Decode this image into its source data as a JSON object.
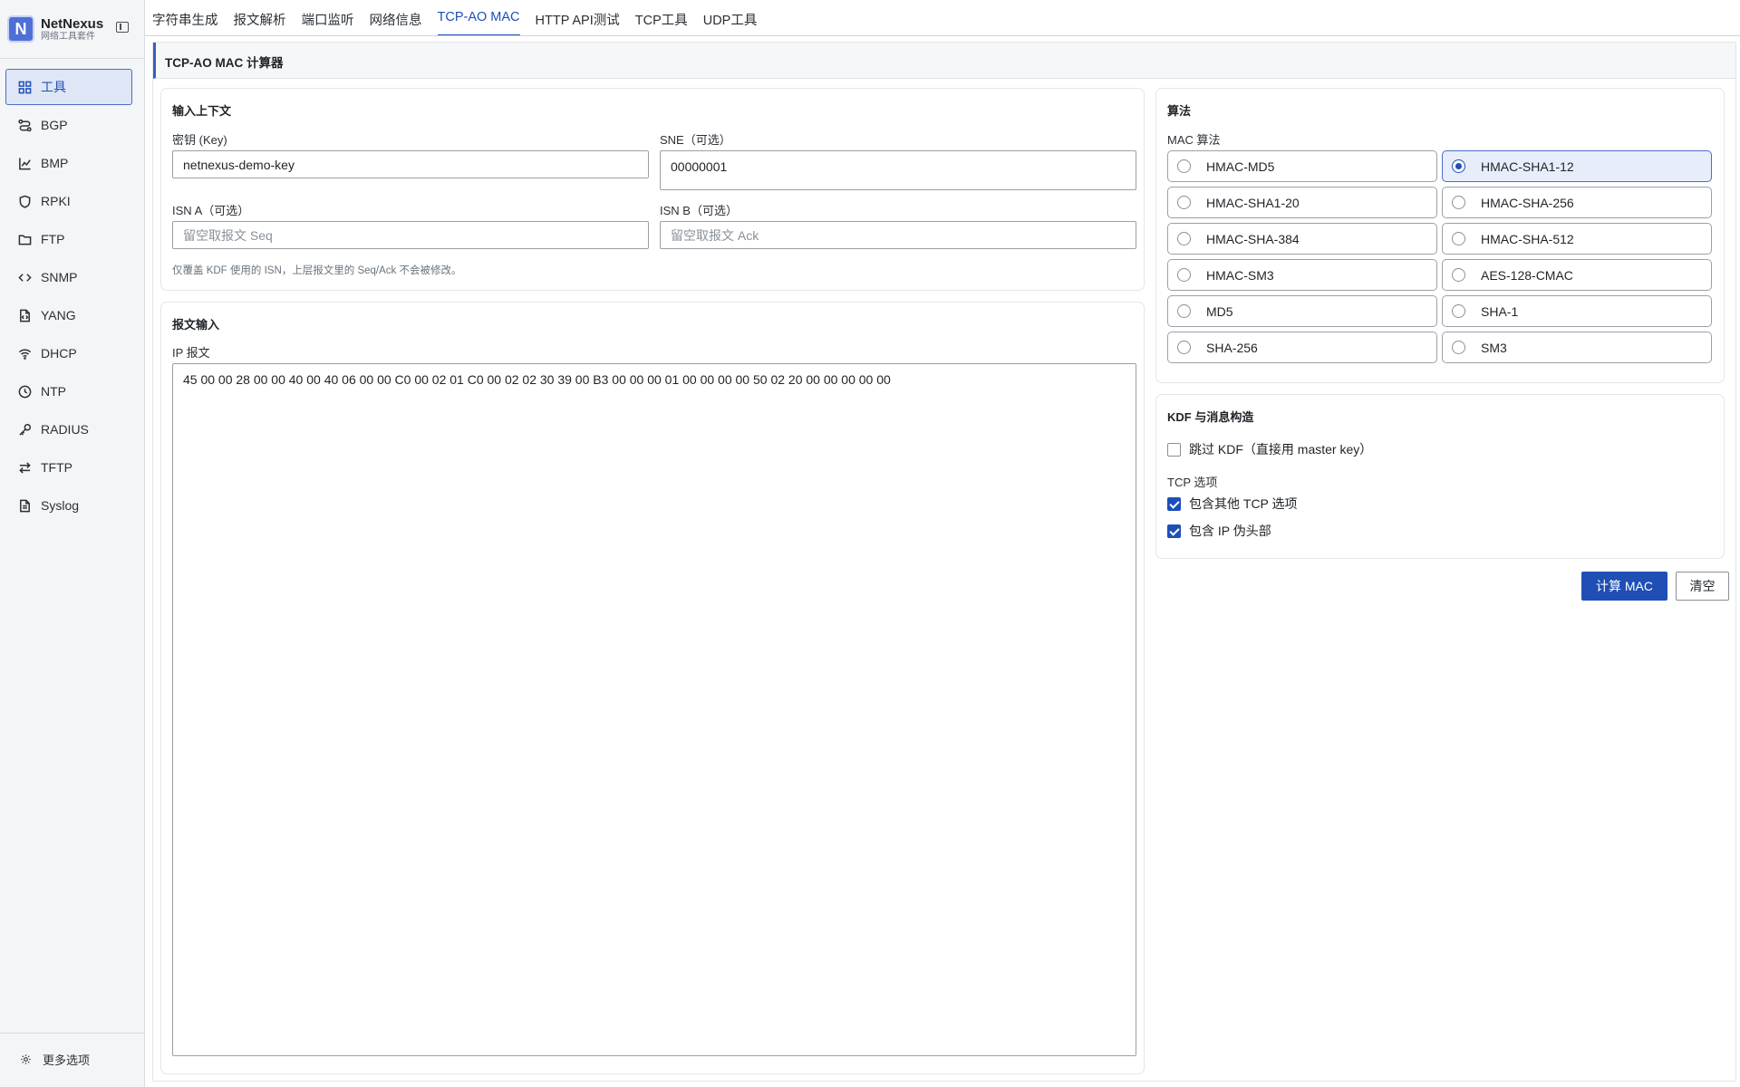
{
  "brand": {
    "logo_letter": "N",
    "name": "NetNexus",
    "subtitle": "网络工具套件"
  },
  "sidebar": {
    "items": [
      {
        "label": "工具",
        "icon": "grid-icon",
        "active": true
      },
      {
        "label": "BGP",
        "icon": "route-icon"
      },
      {
        "label": "BMP",
        "icon": "chart-icon"
      },
      {
        "label": "RPKI",
        "icon": "shield-icon"
      },
      {
        "label": "FTP",
        "icon": "folder-icon"
      },
      {
        "label": "SNMP",
        "icon": "code-icon"
      },
      {
        "label": "YANG",
        "icon": "file-code-icon"
      },
      {
        "label": "DHCP",
        "icon": "wifi-icon"
      },
      {
        "label": "NTP",
        "icon": "clock-icon"
      },
      {
        "label": "RADIUS",
        "icon": "key-icon"
      },
      {
        "label": "TFTP",
        "icon": "transfer-icon"
      },
      {
        "label": "Syslog",
        "icon": "file-text-icon"
      }
    ],
    "more_label": "更多选项"
  },
  "tabs": [
    {
      "label": "字符串生成"
    },
    {
      "label": "报文解析"
    },
    {
      "label": "端口监听"
    },
    {
      "label": "网络信息"
    },
    {
      "label": "TCP-AO MAC",
      "active": true
    },
    {
      "label": "HTTP API测试"
    },
    {
      "label": "TCP工具"
    },
    {
      "label": "UDP工具"
    }
  ],
  "panel": {
    "title": "TCP-AO MAC 计算器"
  },
  "context": {
    "title": "输入上下文",
    "key_label": "密钥 (Key)",
    "key_value": "netnexus-demo-key",
    "sne_label": "SNE（可选）",
    "sne_value": "00000001",
    "isn_a_label": "ISN A（可选）",
    "isn_a_placeholder": "留空取报文 Seq",
    "isn_b_label": "ISN B（可选）",
    "isn_b_placeholder": "留空取报文 Ack",
    "hint": "仅覆盖 KDF 使用的 ISN，上层报文里的 Seq/Ack 不会被修改。"
  },
  "packet": {
    "title": "报文输入",
    "ip_label": "IP 报文",
    "ip_value": "45 00 00 28 00 00 40 00 40 06 00 00 C0 00 02 01 C0 00 02 02 30 39 00 B3 00 00 00 01 00 00 00 00 50 02 20 00 00 00 00 00"
  },
  "algorithm": {
    "title": "算法",
    "mac_label": "MAC 算法",
    "options": [
      {
        "label": "HMAC-MD5",
        "selected": false
      },
      {
        "label": "HMAC-SHA1-12",
        "selected": true
      },
      {
        "label": "HMAC-SHA1-20",
        "selected": false
      },
      {
        "label": "HMAC-SHA-256",
        "selected": false
      },
      {
        "label": "HMAC-SHA-384",
        "selected": false
      },
      {
        "label": "HMAC-SHA-512",
        "selected": false
      },
      {
        "label": "HMAC-SM3",
        "selected": false
      },
      {
        "label": "AES-128-CMAC",
        "selected": false
      },
      {
        "label": "MD5",
        "selected": false
      },
      {
        "label": "SHA-1",
        "selected": false
      },
      {
        "label": "SHA-256",
        "selected": false
      },
      {
        "label": "SM3",
        "selected": false
      }
    ]
  },
  "kdf": {
    "title": "KDF 与消息构造",
    "skip_kdf_label": "跳过 KDF（直接用 master key）",
    "skip_kdf_checked": false,
    "tcp_options_label": "TCP 选项",
    "include_other_tcp_label": "包含其他 TCP 选项",
    "include_other_tcp_checked": true,
    "include_ip_pseudo_label": "包含 IP 伪头部",
    "include_ip_pseudo_checked": true
  },
  "actions": {
    "compute_label": "计算 MAC",
    "clear_label": "清空"
  },
  "colors": {
    "accent": "#1d4fb8",
    "primary_button": "#1f4fb5",
    "selected_bg": "#e7edfb",
    "sidebar_bg": "#f4f5f7"
  }
}
